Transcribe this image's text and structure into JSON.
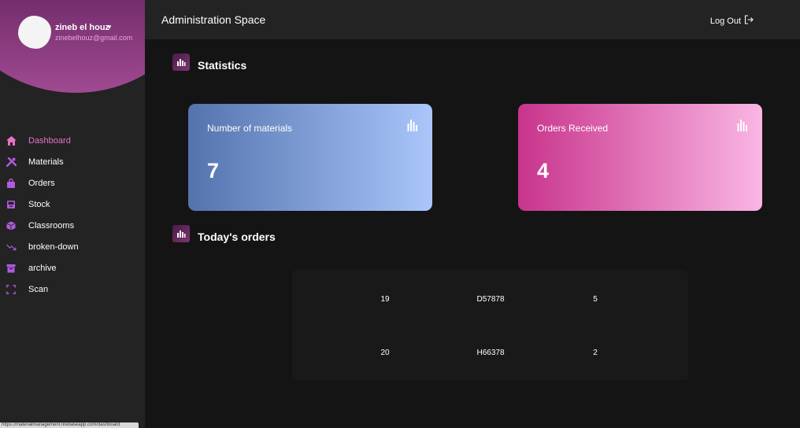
{
  "user": {
    "name": "zineb el houz",
    "email": "zinebelhouz@gmail.com"
  },
  "sidebar": {
    "items": [
      {
        "label": "Dashboard",
        "icon": "home-icon",
        "active": true
      },
      {
        "label": "Materials",
        "icon": "tools-icon",
        "active": false
      },
      {
        "label": "Orders",
        "icon": "bag-icon",
        "active": false
      },
      {
        "label": "Stock",
        "icon": "inbox-icon",
        "active": false
      },
      {
        "label": "Classrooms",
        "icon": "cube-icon",
        "active": false
      },
      {
        "label": "broken-down",
        "icon": "trend-down-icon",
        "active": false
      },
      {
        "label": "archive",
        "icon": "archive-icon",
        "active": false
      },
      {
        "label": "Scan",
        "icon": "scan-icon",
        "active": false
      }
    ]
  },
  "header": {
    "title": "Administration Space",
    "logout_label": "Log Out"
  },
  "main": {
    "statistics_title": "Statistics",
    "todays_orders_title": "Today's orders",
    "cards": {
      "materials": {
        "label": "Number of materials",
        "value": "7"
      },
      "orders": {
        "label": "Orders Received",
        "value": "4"
      }
    },
    "orders": [
      {
        "id": "19",
        "code": "D57878",
        "qty": "5"
      },
      {
        "id": "20",
        "code": "H66378",
        "qty": "2"
      }
    ]
  },
  "status_bar": {
    "url": "https://materialmanagement.firebaseapp.com/dashboard"
  },
  "colors": {
    "accent": "#e870c9",
    "icon_purple": "#b15ae0",
    "sidebar_bg": "#232323",
    "main_bg": "#141414"
  }
}
